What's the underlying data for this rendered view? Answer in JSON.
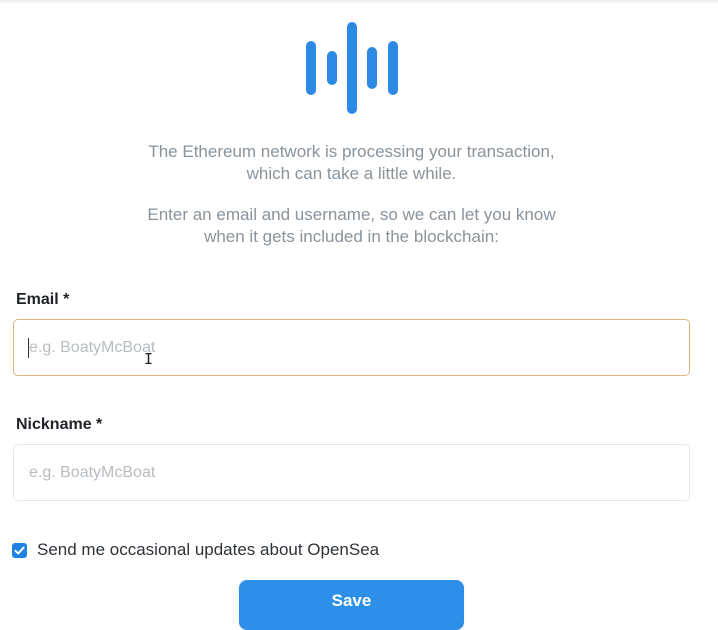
{
  "logo": {
    "icon": "sound-wave-icon",
    "color": "#2c8ae5"
  },
  "message": {
    "line1": "The Ethereum network is processing your transaction,",
    "line2": "which can take a little while.",
    "line3": "Enter an email and username, so we can let you know",
    "line4": "when it gets included in the blockchain:"
  },
  "form": {
    "email": {
      "label": "Email *",
      "placeholder": "e.g. BoatyMcBoat",
      "value": ""
    },
    "nickname": {
      "label": "Nickname *",
      "placeholder": "e.g. BoatyMcBoat",
      "value": ""
    },
    "updates_checkbox": {
      "label": "Send me occasional updates about OpenSea",
      "checked": true
    },
    "save_label": "Save"
  },
  "colors": {
    "accent": "#2081e2",
    "focus_border": "#e0b67a",
    "body_text": "#8a939b"
  }
}
